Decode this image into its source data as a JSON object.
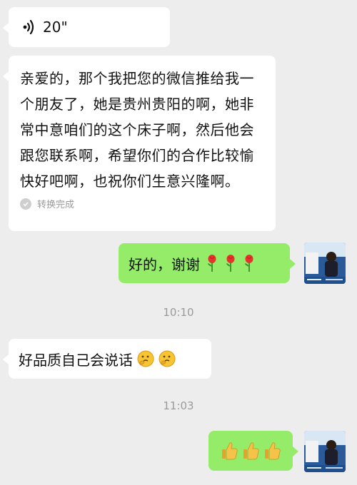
{
  "messages": {
    "voice": {
      "duration": "20\""
    },
    "transcript": {
      "text": "亲爱的，那个我把您的微信推给我一个朋友了，她是贵州贵阳的啊，她非常中意咱们的这个床子啊，然后他会跟您联系啊，希望你们的合作比较愉快好吧啊，也祝你们生意兴隆啊。",
      "status": "转换完成"
    },
    "reply1": {
      "text": "好的，谢谢",
      "emojis": [
        "rose-emoji",
        "rose-emoji",
        "rose-emoji"
      ]
    },
    "time1": "10:10",
    "quality": {
      "text": "好品质自己会说话",
      "emojis": [
        "thinking-face-emoji",
        "thinking-face-emoji"
      ]
    },
    "time2": "11:03",
    "reply2": {
      "emojis": [
        "thumbs-up-emoji",
        "thumbs-up-emoji",
        "thumbs-up-emoji"
      ]
    }
  },
  "colors": {
    "background": "#ededed",
    "incoming": "#ffffff",
    "outgoing": "#95ec69",
    "meta": "#9a9a9a"
  }
}
